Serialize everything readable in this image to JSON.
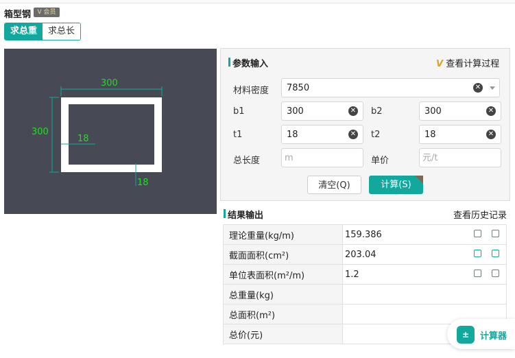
{
  "page": {
    "title": "箱型钢",
    "vip_badge": "V 会员"
  },
  "tabs": [
    {
      "label": "求总重",
      "active": true
    },
    {
      "label": "求总长",
      "active": false
    }
  ],
  "diagram": {
    "width_label": "300",
    "height_label": "300",
    "t1_label": "18",
    "t2_label": "18"
  },
  "params": {
    "section_title": "参数输入",
    "view_process": "查看计算过程",
    "density": {
      "label": "材料密度",
      "value": "7850"
    },
    "b1": {
      "label": "b1",
      "value": "300"
    },
    "b2": {
      "label": "b2",
      "value": "300"
    },
    "t1": {
      "label": "t1",
      "value": "18"
    },
    "t2": {
      "label": "t2",
      "value": "18"
    },
    "length": {
      "label": "总长度",
      "placeholder": "m"
    },
    "price": {
      "label": "单价",
      "placeholder": "元/t"
    },
    "clear_button": "清空(Q)",
    "calc_button": "计算(S)"
  },
  "results": {
    "section_title": "结果输出",
    "history_link": "查看历史记录",
    "rows": [
      {
        "label": "理论重量(kg/m)",
        "value": "159.386"
      },
      {
        "label": "截面面积(cm²)",
        "value": "203.04"
      },
      {
        "label": "单位表面积(m²/m)",
        "value": "1.2"
      },
      {
        "label": "总重量(kg)",
        "value": ""
      },
      {
        "label": "总面积(m²)",
        "value": ""
      },
      {
        "label": "总价(元)",
        "value": ""
      }
    ]
  },
  "calculator_widget": {
    "label": "计算器",
    "icon": "calculator-icon"
  },
  "colors": {
    "accent": "#13a89e",
    "canvas_bg": "#474a55",
    "dimension_text": "#22dd22"
  }
}
